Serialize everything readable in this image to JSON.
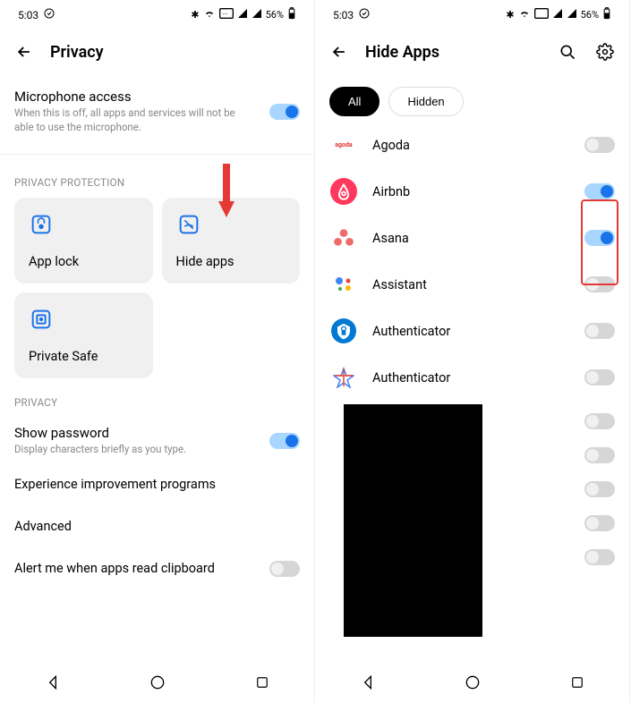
{
  "status": {
    "time": "5:03",
    "battery": "56%"
  },
  "left": {
    "title": "Privacy",
    "mic": {
      "title": "Microphone access",
      "sub": "When this is off, all apps and services will not be able to use the microphone.",
      "on": true
    },
    "section1": "PRIVACY PROTECTION",
    "cards": {
      "app_lock": "App lock",
      "hide_apps": "Hide apps",
      "private_safe": "Private Safe"
    },
    "section2": "PRIVACY",
    "show_pw": {
      "title": "Show password",
      "sub": "Display characters briefly as you type.",
      "on": true
    },
    "exp": "Experience improvement programs",
    "adv": "Advanced",
    "clipboard": {
      "title": "Alert me when apps read clipboard",
      "on": false
    }
  },
  "right": {
    "title": "Hide Apps",
    "chips": {
      "all": "All",
      "hidden": "Hidden"
    },
    "apps": [
      {
        "name": "Agoda",
        "on": false
      },
      {
        "name": "Airbnb",
        "on": true
      },
      {
        "name": "Asana",
        "on": true
      },
      {
        "name": "Assistant",
        "on": false
      },
      {
        "name": "Authenticator",
        "on": false
      },
      {
        "name": "Authenticator",
        "on": false
      }
    ],
    "extra_toggles": [
      false,
      false,
      false,
      false,
      false
    ]
  }
}
